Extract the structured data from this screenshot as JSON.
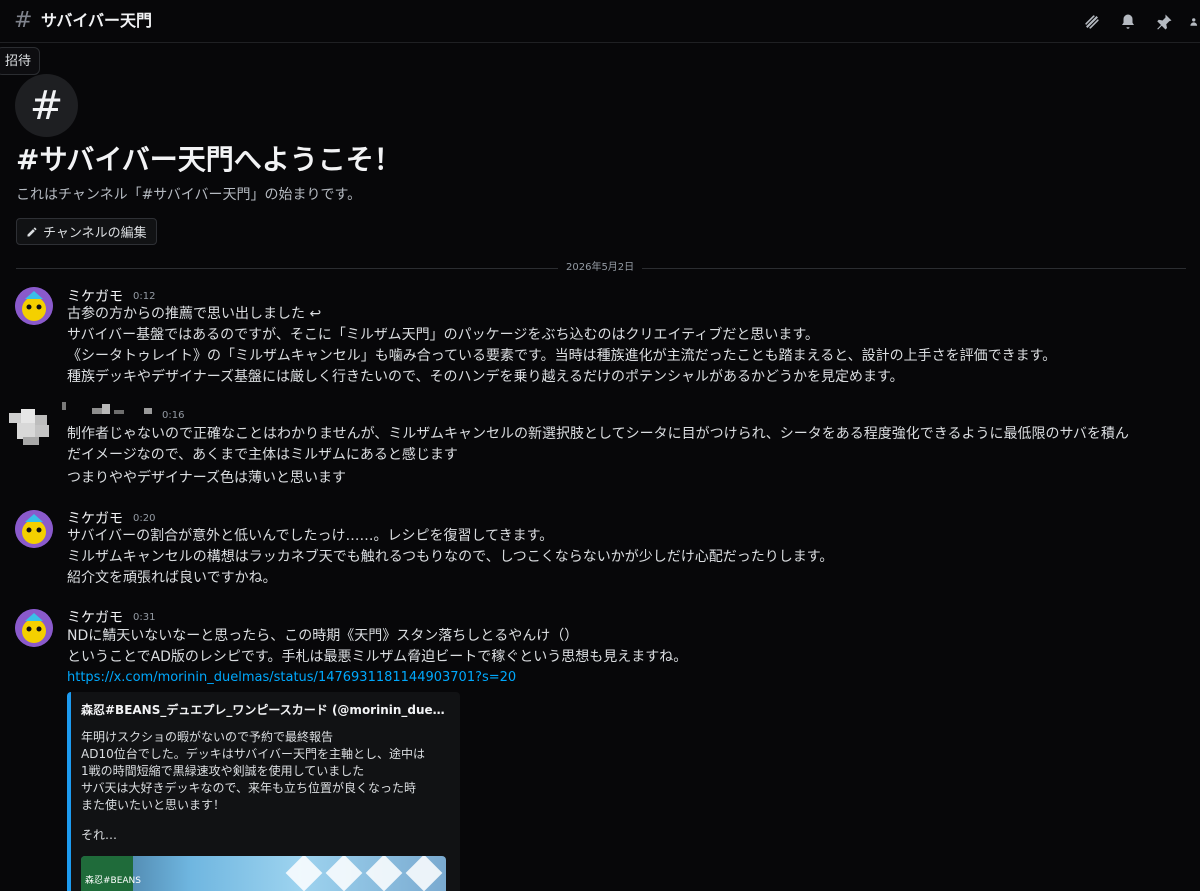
{
  "header": {
    "hash": "#",
    "title": "サバイバー天門",
    "icons": [
      "threads-icon",
      "bell-icon",
      "pin-icon",
      "members-icon"
    ]
  },
  "tooltip": "招待",
  "welcome": {
    "avatar_glyph": "#",
    "title": "#サバイバー天門へようこそ！",
    "subtitle": "これはチャンネル「#サバイバー天門」の始まりです。",
    "edit_button": "チャンネルの編集"
  },
  "divider_date": "2026年5月2日",
  "messages": [
    {
      "author": "ミケガモ",
      "time": "0:12",
      "lines": [
        "古参の方からの推薦で思い出しました ↩",
        "サバイバー基盤ではあるのですが、そこに「ミルザム天門」のパッケージをぶち込むのはクリエイティブだと思います。",
        "《シータトゥレイト》の「ミルザムキャンセル」も噛み合っている要素です。当時は種族進化が主流だったことも踏まえると、設計の上手さを評価できます。",
        "種族デッキやデザイナーズ基盤には厳しく行きたいので、そのハンデを乗り越えるだけのポテンシャルがあるかどうかを見定めます。"
      ]
    },
    {
      "author": "",
      "time": "0:16",
      "lines": [
        "制作者じゃないので正確なことはわかりませんが、ミルザムキャンセルの新選択肢としてシータに目がつけられ、シータをある程度強化できるように最低限のサバを積ん",
        "だイメージなので、あくまで主体はミルザムにあると感じます",
        "つまりややデザイナーズ色は薄いと思います"
      ]
    },
    {
      "author": "ミケガモ",
      "time": "0:20",
      "lines": [
        "サバイバーの割合が意外と低いんでしたっけ……。レシピを復習してきます。",
        "ミルザムキャンセルの構想はラッカネブ天でも触れるつもりなので、しつこくならないかが少しだけ心配だったりします。",
        "紹介文を頑張れば良いですかね。"
      ]
    },
    {
      "author": "ミケガモ",
      "time": "0:31",
      "lines": [
        "NDに鯖天いないなーと思ったら、この時期《天門》スタン落ちしとるやんけ（）",
        "ということでAD版のレシピです。手札は最悪ミルザム脅迫ビートで稼ぐという思想も見えますね。"
      ],
      "link": "https://x.com/morinin_duelmas/status/1476931181144903701?s=20",
      "embed": {
        "author": "森忍#BEANS_デュエプレ_ワンピースカード (@morinin_due…",
        "lines": [
          "年明けスクショの暇がないので予約で最終報告",
          "AD10位台でした。デッキはサバイバー天門を主軸とし、途中は",
          "1戦の時間短縮で黒緑速攻や剣誠を使用していました",
          "サバ天は大好きデッキなので、来年も立ち位置が良くなった時",
          "また使いたいと思います！",
          "",
          "それ…"
        ],
        "image_label": "森忍#BEANS"
      }
    }
  ],
  "colors": {
    "background": "#070709",
    "link": "#00a8fc",
    "embed_border": "#1d9bf0"
  }
}
